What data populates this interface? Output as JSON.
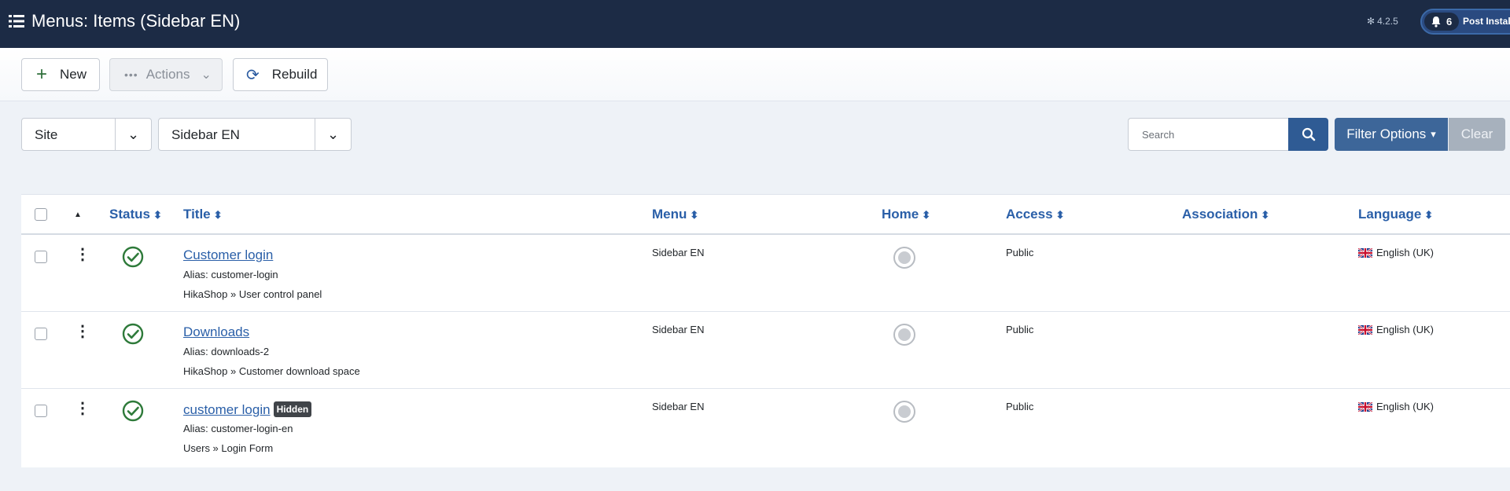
{
  "header": {
    "title": "Menus: Items (Sidebar EN)",
    "version": "4.2.5",
    "notifications_count": "6",
    "post_install_label": "Post Install"
  },
  "toolbar": {
    "new_label": "New",
    "actions_label": "Actions",
    "rebuild_label": "Rebuild"
  },
  "filters": {
    "client_selected": "Site",
    "menu_selected": "Sidebar EN",
    "search_placeholder": "Search",
    "filter_options_label": "Filter Options",
    "clear_label": "Clear"
  },
  "table": {
    "columns": {
      "status": "Status",
      "title": "Title",
      "menu": "Menu",
      "home": "Home",
      "access": "Access",
      "association": "Association",
      "language": "Language"
    },
    "rows": [
      {
        "title": "Customer login",
        "hidden_badge": "",
        "alias": "Alias: customer-login",
        "type": "HikaShop » User control panel",
        "menu": "Sidebar EN",
        "access": "Public",
        "language": "English (UK)"
      },
      {
        "title": "Downloads",
        "hidden_badge": "",
        "alias": "Alias: downloads-2",
        "type": "HikaShop » Customer download space",
        "menu": "Sidebar EN",
        "access": "Public",
        "language": "English (UK)"
      },
      {
        "title": "customer login",
        "hidden_badge": "Hidden",
        "alias": "Alias: customer-login-en",
        "type": "Users » Login Form",
        "menu": "Sidebar EN",
        "access": "Public",
        "language": "English (UK)"
      }
    ]
  },
  "icons": {
    "menu": "list-icon",
    "joomla": "joomla-icon",
    "bell": "bell-icon",
    "new": "plus-icon",
    "actions": "ellipsis-icon",
    "rebuild": "refresh-icon",
    "search": "search-icon",
    "status": "check-circle-icon",
    "home": "home-radio-icon",
    "flag": "uk-flag-icon"
  },
  "colors": {
    "header_bg": "#1c2b45",
    "link": "#2a5fa8",
    "published": "#2e7a3a",
    "search_button": "#2f5b94",
    "filter_button": "#3d6699"
  }
}
